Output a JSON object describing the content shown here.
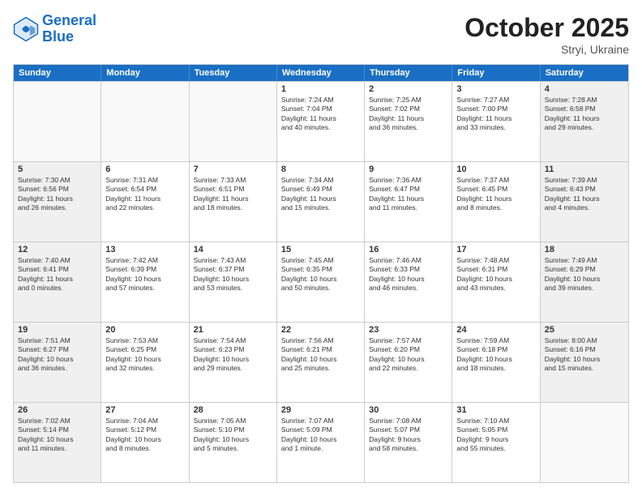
{
  "header": {
    "logo_line1": "General",
    "logo_line2": "Blue",
    "month": "October 2025",
    "location": "Stryi, Ukraine"
  },
  "days_of_week": [
    "Sunday",
    "Monday",
    "Tuesday",
    "Wednesday",
    "Thursday",
    "Friday",
    "Saturday"
  ],
  "weeks": [
    [
      {
        "day": "",
        "info": ""
      },
      {
        "day": "",
        "info": ""
      },
      {
        "day": "",
        "info": ""
      },
      {
        "day": "1",
        "info": "Sunrise: 7:24 AM\nSunset: 7:04 PM\nDaylight: 11 hours\nand 40 minutes."
      },
      {
        "day": "2",
        "info": "Sunrise: 7:25 AM\nSunset: 7:02 PM\nDaylight: 11 hours\nand 36 minutes."
      },
      {
        "day": "3",
        "info": "Sunrise: 7:27 AM\nSunset: 7:00 PM\nDaylight: 11 hours\nand 33 minutes."
      },
      {
        "day": "4",
        "info": "Sunrise: 7:28 AM\nSunset: 6:58 PM\nDaylight: 11 hours\nand 29 minutes."
      }
    ],
    [
      {
        "day": "5",
        "info": "Sunrise: 7:30 AM\nSunset: 6:56 PM\nDaylight: 11 hours\nand 26 minutes."
      },
      {
        "day": "6",
        "info": "Sunrise: 7:31 AM\nSunset: 6:54 PM\nDaylight: 11 hours\nand 22 minutes."
      },
      {
        "day": "7",
        "info": "Sunrise: 7:33 AM\nSunset: 6:51 PM\nDaylight: 11 hours\nand 18 minutes."
      },
      {
        "day": "8",
        "info": "Sunrise: 7:34 AM\nSunset: 6:49 PM\nDaylight: 11 hours\nand 15 minutes."
      },
      {
        "day": "9",
        "info": "Sunrise: 7:36 AM\nSunset: 6:47 PM\nDaylight: 11 hours\nand 11 minutes."
      },
      {
        "day": "10",
        "info": "Sunrise: 7:37 AM\nSunset: 6:45 PM\nDaylight: 11 hours\nand 8 minutes."
      },
      {
        "day": "11",
        "info": "Sunrise: 7:39 AM\nSunset: 6:43 PM\nDaylight: 11 hours\nand 4 minutes."
      }
    ],
    [
      {
        "day": "12",
        "info": "Sunrise: 7:40 AM\nSunset: 6:41 PM\nDaylight: 11 hours\nand 0 minutes."
      },
      {
        "day": "13",
        "info": "Sunrise: 7:42 AM\nSunset: 6:39 PM\nDaylight: 10 hours\nand 57 minutes."
      },
      {
        "day": "14",
        "info": "Sunrise: 7:43 AM\nSunset: 6:37 PM\nDaylight: 10 hours\nand 53 minutes."
      },
      {
        "day": "15",
        "info": "Sunrise: 7:45 AM\nSunset: 6:35 PM\nDaylight: 10 hours\nand 50 minutes."
      },
      {
        "day": "16",
        "info": "Sunrise: 7:46 AM\nSunset: 6:33 PM\nDaylight: 10 hours\nand 46 minutes."
      },
      {
        "day": "17",
        "info": "Sunrise: 7:48 AM\nSunset: 6:31 PM\nDaylight: 10 hours\nand 43 minutes."
      },
      {
        "day": "18",
        "info": "Sunrise: 7:49 AM\nSunset: 6:29 PM\nDaylight: 10 hours\nand 39 minutes."
      }
    ],
    [
      {
        "day": "19",
        "info": "Sunrise: 7:51 AM\nSunset: 6:27 PM\nDaylight: 10 hours\nand 36 minutes."
      },
      {
        "day": "20",
        "info": "Sunrise: 7:53 AM\nSunset: 6:25 PM\nDaylight: 10 hours\nand 32 minutes."
      },
      {
        "day": "21",
        "info": "Sunrise: 7:54 AM\nSunset: 6:23 PM\nDaylight: 10 hours\nand 29 minutes."
      },
      {
        "day": "22",
        "info": "Sunrise: 7:56 AM\nSunset: 6:21 PM\nDaylight: 10 hours\nand 25 minutes."
      },
      {
        "day": "23",
        "info": "Sunrise: 7:57 AM\nSunset: 6:20 PM\nDaylight: 10 hours\nand 22 minutes."
      },
      {
        "day": "24",
        "info": "Sunrise: 7:59 AM\nSunset: 6:18 PM\nDaylight: 10 hours\nand 18 minutes."
      },
      {
        "day": "25",
        "info": "Sunrise: 8:00 AM\nSunset: 6:16 PM\nDaylight: 10 hours\nand 15 minutes."
      }
    ],
    [
      {
        "day": "26",
        "info": "Sunrise: 7:02 AM\nSunset: 5:14 PM\nDaylight: 10 hours\nand 11 minutes."
      },
      {
        "day": "27",
        "info": "Sunrise: 7:04 AM\nSunset: 5:12 PM\nDaylight: 10 hours\nand 8 minutes."
      },
      {
        "day": "28",
        "info": "Sunrise: 7:05 AM\nSunset: 5:10 PM\nDaylight: 10 hours\nand 5 minutes."
      },
      {
        "day": "29",
        "info": "Sunrise: 7:07 AM\nSunset: 5:09 PM\nDaylight: 10 hours\nand 1 minute."
      },
      {
        "day": "30",
        "info": "Sunrise: 7:08 AM\nSunset: 5:07 PM\nDaylight: 9 hours\nand 58 minutes."
      },
      {
        "day": "31",
        "info": "Sunrise: 7:10 AM\nSunset: 5:05 PM\nDaylight: 9 hours\nand 55 minutes."
      },
      {
        "day": "",
        "info": ""
      }
    ]
  ]
}
